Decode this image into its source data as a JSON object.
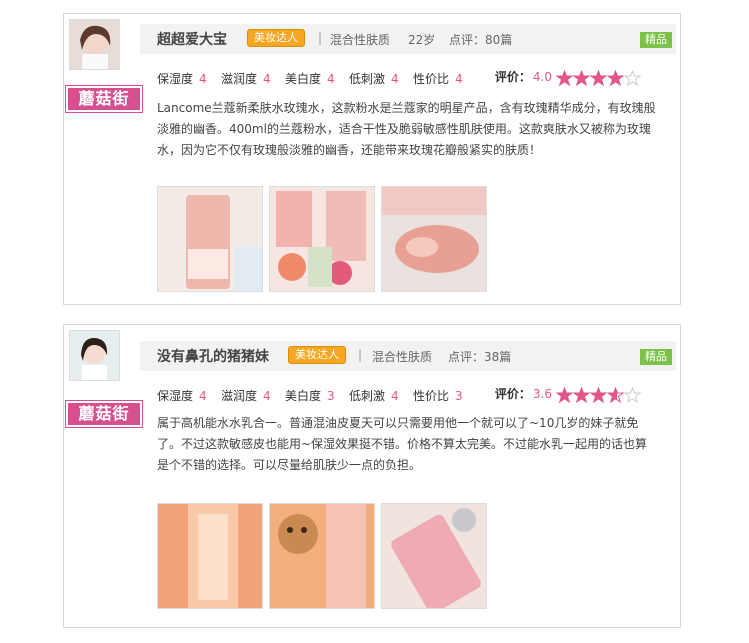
{
  "reviews": [
    {
      "username": "超超爱大宝",
      "badge": "美妆达人",
      "separator": "|",
      "skin": "混合性肤质",
      "age": "22岁",
      "count": "点评：80篇",
      "featured": "精品",
      "brand": "蘑菇街",
      "scores": [
        {
          "label": "保湿度",
          "value": "4"
        },
        {
          "label": "滋润度",
          "value": "4"
        },
        {
          "label": "美白度",
          "value": "4"
        },
        {
          "label": "低刺激",
          "value": "4"
        },
        {
          "label": "性价比",
          "value": "4"
        }
      ],
      "rating_label": "评价：",
      "rating_value": "4.0",
      "rating": 4.0,
      "text": "Lancome兰蔻新柔肤水玫瑰水，这款粉水是兰蔻家的明星产品，含有玫瑰精华成分，有玫瑰般淡雅的幽香。400ml的兰蔻粉水，适合干性及脆弱敏感性肌肤使用。这款爽肤水又被称为玫瑰水，因为它不仅有玫瑰般淡雅的幽香，还能带来玫瑰花瓣般紧实的肤质！"
    },
    {
      "username": "没有鼻孔的猪猪妹",
      "badge": "美妆达人",
      "separator": "|",
      "skin": "混合性肤质",
      "age": "",
      "count": "点评：38篇",
      "featured": "精品",
      "brand": "蘑菇街",
      "scores": [
        {
          "label": "保湿度",
          "value": "4"
        },
        {
          "label": "滋润度",
          "value": "4"
        },
        {
          "label": "美白度",
          "value": "3"
        },
        {
          "label": "低刺激",
          "value": "4"
        },
        {
          "label": "性价比",
          "value": "3"
        }
      ],
      "rating_label": "评价：",
      "rating_value": "3.6",
      "rating": 3.6,
      "text": "属于高机能水水乳合一。普通混油皮夏天可以只需要用他一个就可以了~10几岁的妹子就免了。不过这款敏感皮也能用~保湿效果挺不错。价格不算太完美。不过能水乳一起用的话也算是个不错的选择。可以尽量给肌肤少一点的负担。"
    }
  ],
  "colors": {
    "accent": "#e2578b",
    "brand": "#d64f8f",
    "badge": "#f5a623",
    "featured": "#7cc14a",
    "star_off": "#cccccc"
  }
}
